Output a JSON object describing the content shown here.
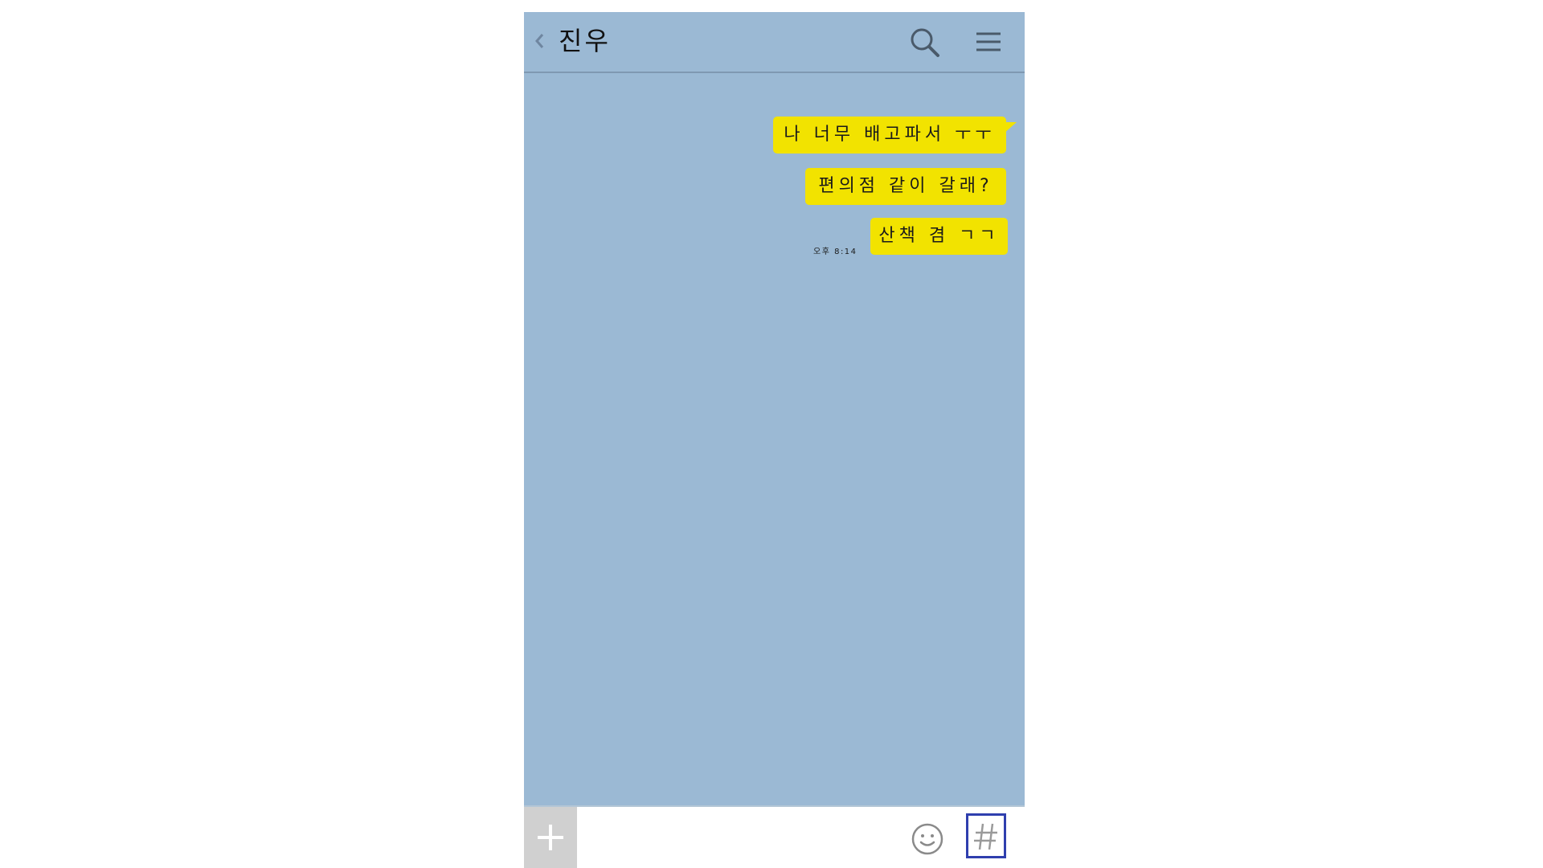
{
  "header": {
    "title": "진우",
    "back_icon": "chevron-left-icon",
    "search_icon": "search-icon",
    "menu_icon": "hamburger-menu-icon"
  },
  "messages": [
    {
      "text": "나 너무 배고파서 ㅜㅜ",
      "sender": "me"
    },
    {
      "text": "편의점 같이 갈래?",
      "sender": "me"
    },
    {
      "text": "산책 겸 ㄱㄱ",
      "sender": "me",
      "time": "오후 8:14"
    }
  ],
  "input_bar": {
    "plus_icon": "plus-icon",
    "emoji_icon": "emoji-icon",
    "hash_icon": "hash-icon"
  },
  "colors": {
    "background": "#9bb9d4",
    "bubble": "#f2e300",
    "hash_border": "#2f3fae"
  }
}
